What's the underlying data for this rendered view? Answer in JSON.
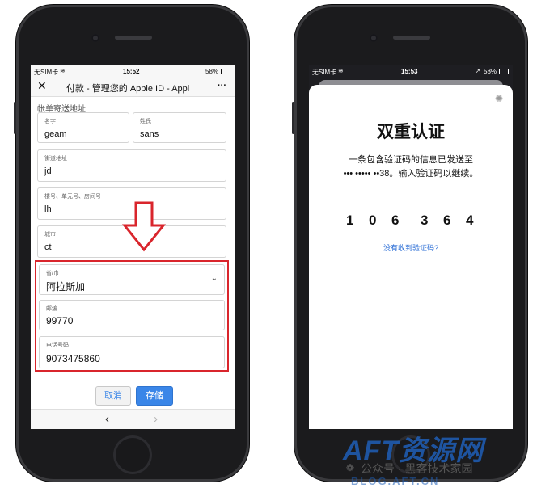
{
  "left_phone": {
    "status": {
      "carrier": "无SIM卡",
      "time": "15:52",
      "battery": "58%"
    },
    "nav": {
      "title": "付款 - 管理您的 Apple ID - Appl",
      "more": "···"
    },
    "section_title": "帐单寄送地址",
    "fields": {
      "first_name": {
        "label": "名字",
        "value": "geam"
      },
      "last_name": {
        "label": "姓氏",
        "value": "sans"
      },
      "street": {
        "label": "街道地址",
        "value": "jd"
      },
      "unit": {
        "label": "楼号、单元号、房间号",
        "value": "lh"
      },
      "city": {
        "label": "城市",
        "value": "ct"
      },
      "province": {
        "label": "省/市",
        "value": "阿拉斯加"
      },
      "zip": {
        "label": "邮编",
        "value": "99770"
      },
      "phone": {
        "label": "电话号码",
        "value": "9073475860"
      }
    },
    "buttons": {
      "cancel": "取消",
      "save": "存储"
    }
  },
  "right_phone": {
    "status": {
      "carrier": "无SIM卡",
      "time": "15:53",
      "battery": "58%"
    },
    "title": "双重认证",
    "message_line1": "一条包含验证码的信息已发送至",
    "message_line2": "••• ••••• ••38。输入验证码以继续。",
    "code_digits": [
      "1",
      "0",
      "6",
      "3",
      "6",
      "4"
    ],
    "resend_link": "没有收到验证码?"
  },
  "watermark": {
    "logo_text": "AFT资源网",
    "line2": "公众号 · 黑客技术家园",
    "line3": "BLOG.AFT.CN"
  },
  "colors": {
    "highlight_red": "#d9252c",
    "link_blue": "#2d6fd6",
    "save_blue": "#3a86e8",
    "watermark_blue": "#1f5fb8"
  }
}
